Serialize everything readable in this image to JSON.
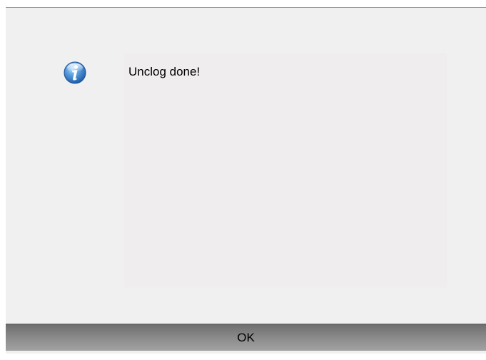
{
  "dialog": {
    "icon": "info-icon",
    "message": "Unclog done!",
    "ok_label": "OK"
  },
  "colors": {
    "dialog_background": "#f0f0f0",
    "message_panel": "#efeded",
    "icon_blue": "#3a7cc4",
    "button_gradient_top": "#6e6e6e",
    "button_gradient_bottom": "#a2a2a2"
  }
}
